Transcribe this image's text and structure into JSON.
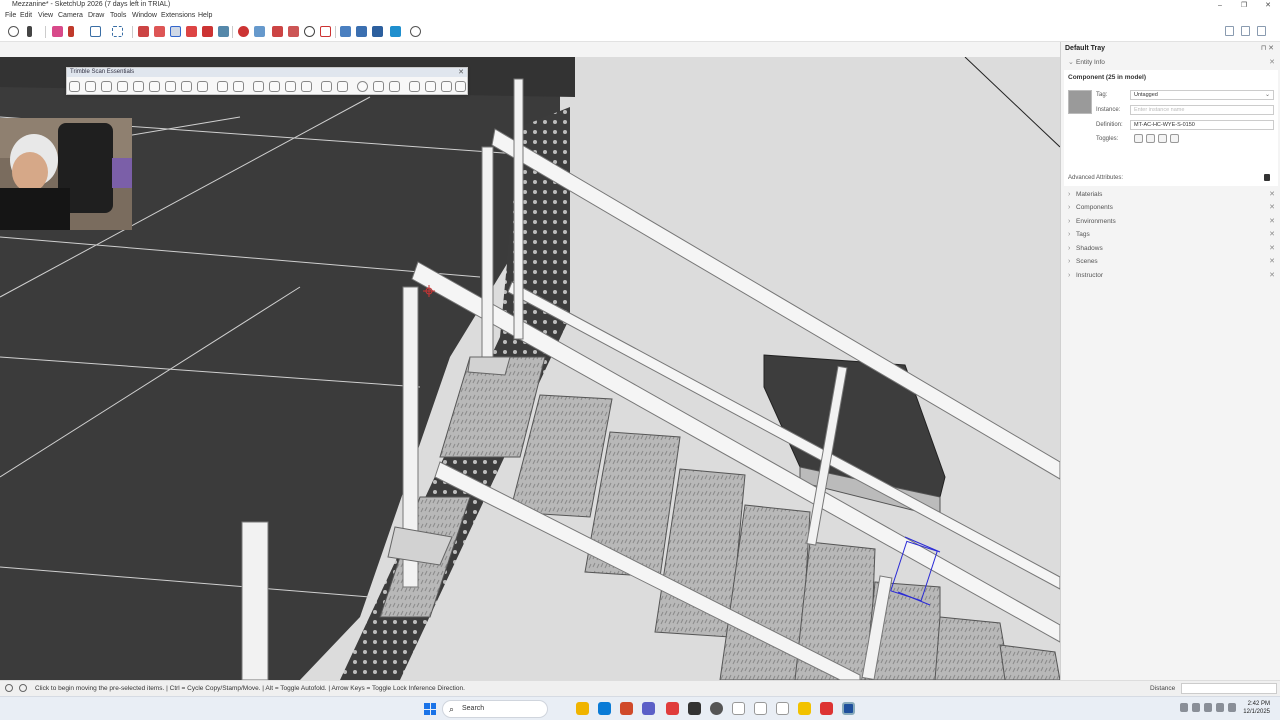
{
  "app": {
    "title": "Mezzanine* - SketchUp 2026 (7 days left in TRIAL)",
    "window_controls": [
      "–",
      "❐",
      "✕"
    ]
  },
  "menu": [
    "File",
    "Edit",
    "View",
    "Camera",
    "Draw",
    "Tools",
    "Window",
    "Extensions",
    "Help"
  ],
  "floating_toolbar": {
    "title": "Trimble Scan Essentials",
    "close": "✕"
  },
  "tray": {
    "title": "Default Tray",
    "title_icons": "⊓ ✕",
    "entity_info": {
      "header": "Entity Info",
      "component_title": "Component (25 in model)",
      "tag_label": "Tag:",
      "tag_value": "Untagged",
      "instance_label": "Instance:",
      "instance_placeholder": "Enter instance name",
      "definition_label": "Definition:",
      "definition_value": "MT-AC-HC-WYE-S-0150",
      "toggles_label": "Toggles:",
      "advanced_label": "Advanced Attributes:"
    },
    "panels": [
      "Materials",
      "Components",
      "Environments",
      "Tags",
      "Shadows",
      "Scenes",
      "Instructor"
    ]
  },
  "status": {
    "text": "Click to begin moving the pre-selected items. | Ctrl = Cycle Copy/Stamp/Move. | Alt = Toggle Autofold. | Arrow Keys = Toggle Lock Inference Direction.",
    "distance_label": "Distance"
  },
  "taskbar": {
    "search": "Search",
    "time": "2:42 PM",
    "date": "12/1/2025"
  },
  "colors": {
    "accent": "#1a73e8",
    "selection": "#2b2bd6",
    "floor": "#3a3a3a",
    "plate": "#b5b5b5"
  }
}
